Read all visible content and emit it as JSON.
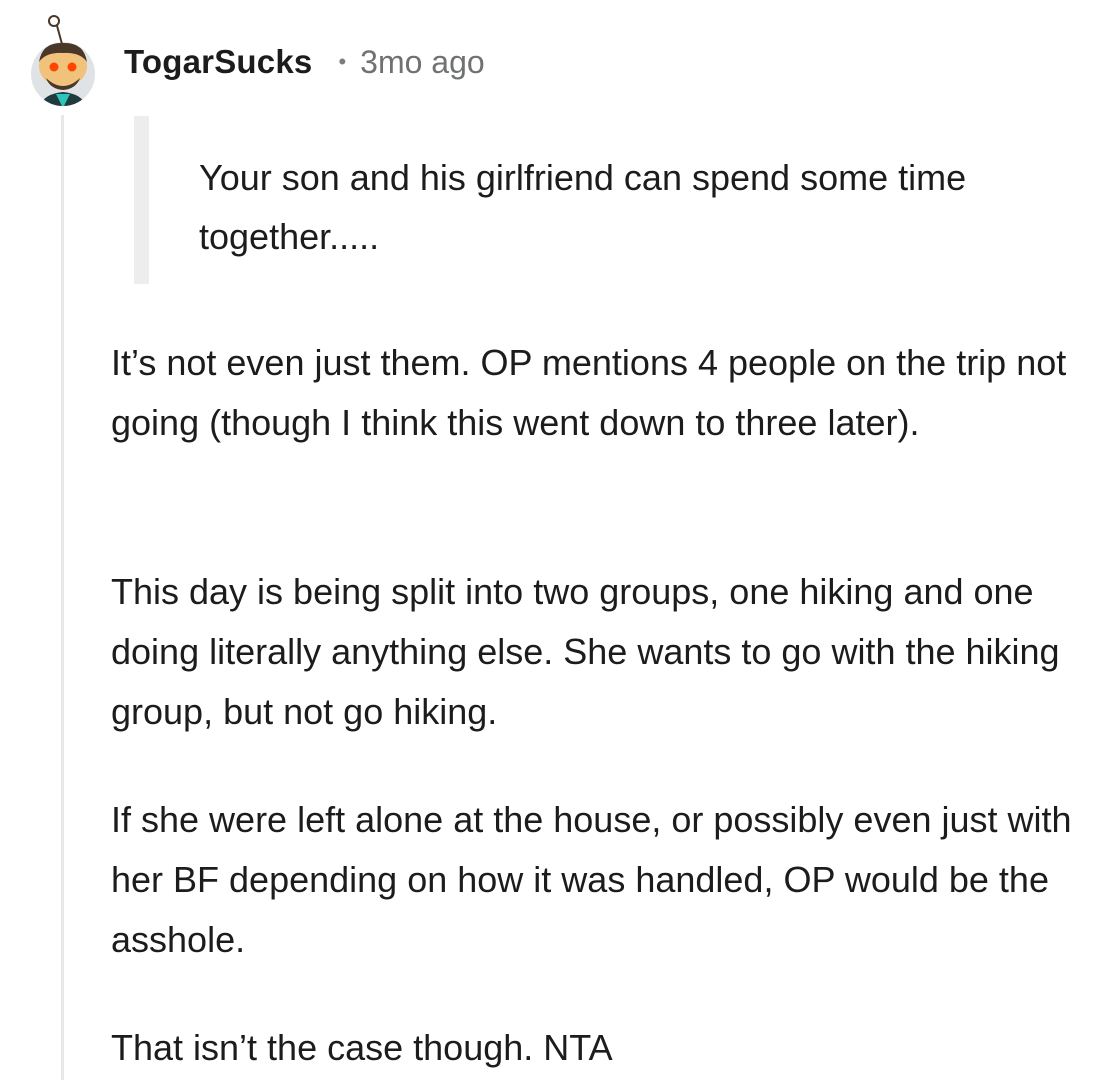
{
  "comment": {
    "author": "TogarSucks",
    "separator": "•",
    "timestamp": "3mo ago",
    "quote": "Your son and his girlfriend can spend some time together.....",
    "paragraphs": [
      "It’s not even just them. OP mentions 4 people on the trip not going (though I think this went down to three later).",
      "This day is being split into two groups, one hiking and one doing literally anything else. She wants to go with the hiking group, but not go hiking.",
      "If she were left alone at the house, or possibly even just with her BF depending on how it was handled, OP would be the asshole.",
      "That isn’t the case though. NTA"
    ]
  },
  "avatar": {
    "icon": "snoo-avatar-icon",
    "colors": {
      "background": "#dfe3e6",
      "skin": "#f0c27b",
      "hair": "#4a3728",
      "eye": "#ff4500",
      "shirt": "#1f3b40",
      "accent": "#2ec4b6"
    }
  },
  "colors": {
    "thread_line": "#e6e8ea",
    "quote_bar": "#ededed",
    "text": "#1c1c1c",
    "meta": "#6f7173"
  }
}
